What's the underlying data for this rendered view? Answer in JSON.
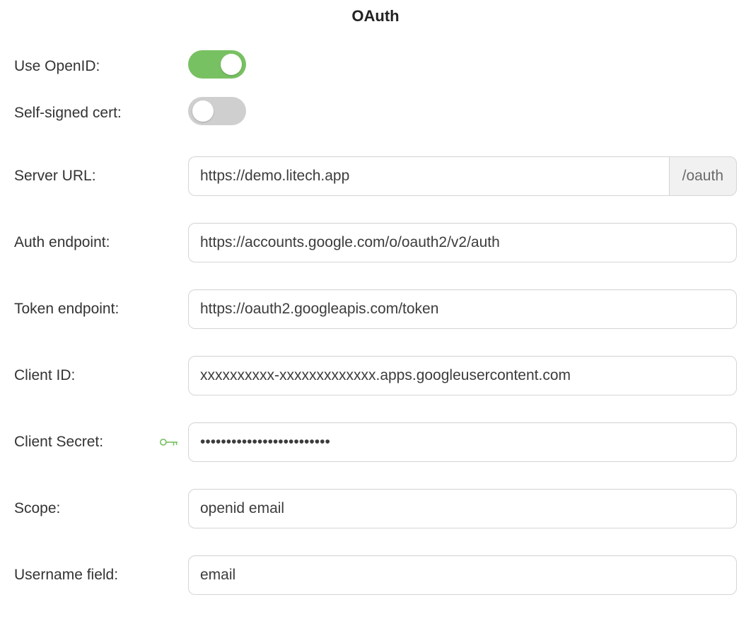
{
  "title": "OAuth",
  "fields": {
    "use_openid": {
      "label": "Use OpenID:",
      "enabled": true
    },
    "self_signed": {
      "label": "Self-signed cert:",
      "enabled": false
    },
    "server_url": {
      "label": "Server URL:",
      "value": "https://demo.litech.app",
      "suffix": "/oauth"
    },
    "auth_endpoint": {
      "label": "Auth endpoint:",
      "value": "https://accounts.google.com/o/oauth2/v2/auth"
    },
    "token_endpoint": {
      "label": "Token endpoint:",
      "value": "https://oauth2.googleapis.com/token"
    },
    "client_id": {
      "label": "Client ID:",
      "value": "xxxxxxxxxx-xxxxxxxxxxxxx.apps.googleusercontent.com"
    },
    "client_secret": {
      "label": "Client Secret:",
      "value": "xxxxxxxxxxxxxxxxxxxxxxxxx"
    },
    "scope": {
      "label": "Scope:",
      "value": "openid email"
    },
    "username_field": {
      "label": "Username field:",
      "value": "email"
    }
  }
}
